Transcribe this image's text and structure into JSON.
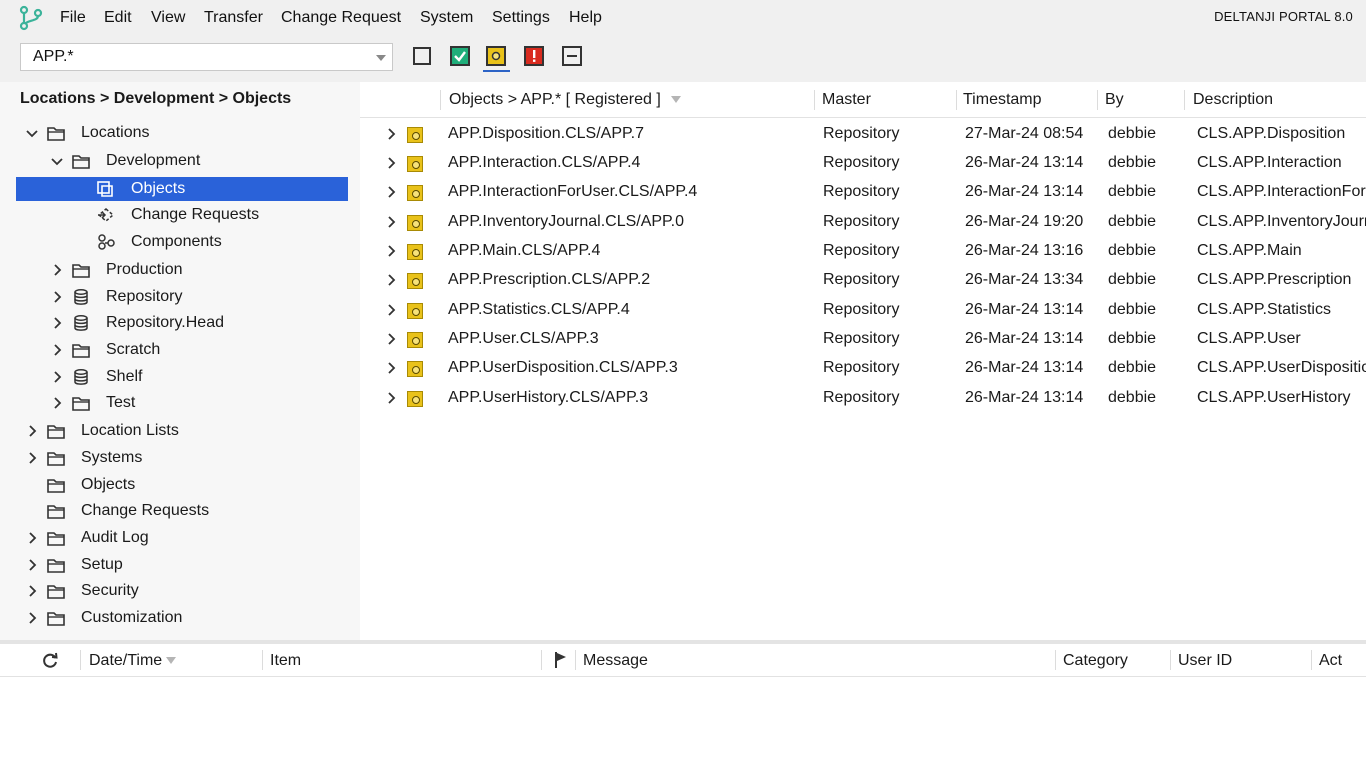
{
  "app": {
    "portal_title": "DELTANJI PORTAL 8.0",
    "brand_color": "#3bb39a",
    "selection_color": "#2a62d9"
  },
  "menu": {
    "items": [
      "File",
      "Edit",
      "View",
      "Transfer",
      "Change Request",
      "System",
      "Settings",
      "Help"
    ]
  },
  "toolbar": {
    "filter_value": "APP.*",
    "buttons": [
      {
        "name": "show-all-button",
        "icon": "empty-square-icon"
      },
      {
        "name": "show-checked-button",
        "icon": "green-check-icon"
      },
      {
        "name": "show-registered-button",
        "icon": "yellow-registered-icon"
      },
      {
        "name": "show-errors-button",
        "icon": "red-exclamation-icon"
      },
      {
        "name": "show-none-button",
        "icon": "minus-square-icon"
      }
    ]
  },
  "tree": {
    "breadcrumb": "Locations > Development > Objects",
    "items": [
      {
        "label": "Locations",
        "icon": "folder-icon",
        "expanded": true
      },
      {
        "label": "Development",
        "icon": "folder-icon",
        "expanded": true
      },
      {
        "label": "Objects",
        "icon": "objects-icon",
        "selected": true
      },
      {
        "label": "Change Requests",
        "icon": "change-request-icon"
      },
      {
        "label": "Components",
        "icon": "components-icon"
      },
      {
        "label": "Production",
        "icon": "folder-icon"
      },
      {
        "label": "Repository",
        "icon": "database-icon"
      },
      {
        "label": "Repository.Head",
        "icon": "database-icon"
      },
      {
        "label": "Scratch",
        "icon": "folder-icon"
      },
      {
        "label": "Shelf",
        "icon": "database-icon"
      },
      {
        "label": "Test",
        "icon": "folder-icon"
      },
      {
        "label": "Location Lists",
        "icon": "folder-icon"
      },
      {
        "label": "Systems",
        "icon": "folder-icon"
      },
      {
        "label": "Objects",
        "icon": "folder-icon"
      },
      {
        "label": "Change Requests",
        "icon": "folder-icon"
      },
      {
        "label": "Audit Log",
        "icon": "folder-icon"
      },
      {
        "label": "Setup",
        "icon": "folder-icon"
      },
      {
        "label": "Security",
        "icon": "folder-icon"
      },
      {
        "label": "Customization",
        "icon": "folder-icon"
      }
    ]
  },
  "grid": {
    "columns": {
      "objects": "Objects > APP.* [ Registered ]",
      "master": "Master",
      "timestamp": "Timestamp",
      "by": "By",
      "description": "Description"
    },
    "rows": [
      {
        "name": "APP.Disposition.CLS/APP.7",
        "master": "Repository",
        "timestamp": "27-Mar-24 08:54",
        "by": "debbie",
        "description": "CLS.APP.Disposition"
      },
      {
        "name": "APP.Interaction.CLS/APP.4",
        "master": "Repository",
        "timestamp": "26-Mar-24 13:14",
        "by": "debbie",
        "description": "CLS.APP.Interaction"
      },
      {
        "name": "APP.InteractionForUser.CLS/APP.4",
        "master": "Repository",
        "timestamp": "26-Mar-24 13:14",
        "by": "debbie",
        "description": "CLS.APP.InteractionForUser"
      },
      {
        "name": "APP.InventoryJournal.CLS/APP.0",
        "master": "Repository",
        "timestamp": "26-Mar-24 19:20",
        "by": "debbie",
        "description": "CLS.APP.InventoryJournal"
      },
      {
        "name": "APP.Main.CLS/APP.4",
        "master": "Repository",
        "timestamp": "26-Mar-24 13:16",
        "by": "debbie",
        "description": "CLS.APP.Main"
      },
      {
        "name": "APP.Prescription.CLS/APP.2",
        "master": "Repository",
        "timestamp": "26-Mar-24 13:34",
        "by": "debbie",
        "description": "CLS.APP.Prescription"
      },
      {
        "name": "APP.Statistics.CLS/APP.4",
        "master": "Repository",
        "timestamp": "26-Mar-24 13:14",
        "by": "debbie",
        "description": "CLS.APP.Statistics"
      },
      {
        "name": "APP.User.CLS/APP.3",
        "master": "Repository",
        "timestamp": "26-Mar-24 13:14",
        "by": "debbie",
        "description": "CLS.APP.User"
      },
      {
        "name": "APP.UserDisposition.CLS/APP.3",
        "master": "Repository",
        "timestamp": "26-Mar-24 13:14",
        "by": "debbie",
        "description": "CLS.APP.UserDisposition"
      },
      {
        "name": "APP.UserHistory.CLS/APP.3",
        "master": "Repository",
        "timestamp": "26-Mar-24 13:14",
        "by": "debbie",
        "description": "CLS.APP.UserHistory"
      }
    ]
  },
  "log": {
    "columns": {
      "datetime": "Date/Time",
      "item": "Item",
      "message": "Message",
      "category": "Category",
      "user_id": "User ID",
      "action": "Act"
    }
  }
}
